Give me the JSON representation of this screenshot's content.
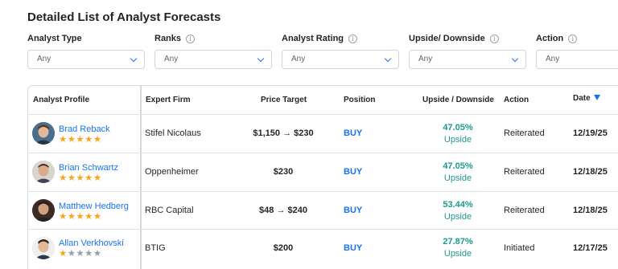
{
  "title": "Detailed List of Analyst Forecasts",
  "filters": [
    {
      "label": "Analyst Type",
      "value": "Any",
      "info": false
    },
    {
      "label": "Ranks",
      "value": "Any",
      "info": true
    },
    {
      "label": "Analyst Rating",
      "value": "Any",
      "info": true
    },
    {
      "label": "Upside/ Downside",
      "value": "Any",
      "info": true
    },
    {
      "label": "Action",
      "value": "Any",
      "info": true
    }
  ],
  "columns": {
    "profile": "Analyst Profile",
    "firm": "Expert Firm",
    "price_target": "Price Target",
    "position": "Position",
    "upside": "Upside / Downside",
    "action": "Action",
    "date": "Date"
  },
  "rows": [
    {
      "name": "Brad Reback",
      "stars": 5,
      "firm": "Stifel Nicolaus",
      "price_target": "$1,150 → $230",
      "position": "BUY",
      "upside_pct": "47.05%",
      "upside_label": "Upside",
      "action": "Reiterated",
      "date": "12/19/25"
    },
    {
      "name": "Brian Schwartz",
      "stars": 5,
      "firm": "Oppenheimer",
      "price_target": "$230",
      "position": "BUY",
      "upside_pct": "47.05%",
      "upside_label": "Upside",
      "action": "Reiterated",
      "date": "12/18/25"
    },
    {
      "name": "Matthew Hedberg",
      "stars": 5,
      "firm": "RBC Capital",
      "price_target": "$48 → $240",
      "position": "BUY",
      "upside_pct": "53.44%",
      "upside_label": "Upside",
      "action": "Reiterated",
      "date": "12/18/25"
    },
    {
      "name": "Allan Verkhovski",
      "stars": 1,
      "firm": "BTIG",
      "price_target": "$200",
      "position": "BUY",
      "upside_pct": "27.87%",
      "upside_label": "Upside",
      "action": "Initiated",
      "date": "12/17/25"
    }
  ],
  "colors": {
    "accent": "#1a73e8",
    "upside": "#1a9a8f",
    "star": "#f5a623",
    "star_empty": "#9aa0a6"
  }
}
